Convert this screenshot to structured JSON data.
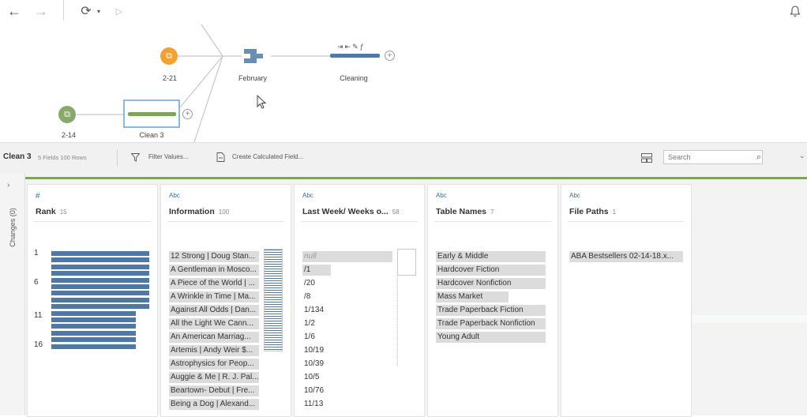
{
  "flow": {
    "nodes": {
      "input_a": "2-21",
      "input_b": "2-14",
      "february": "February",
      "clean3": "Clean 3",
      "cleaning": "Cleaning"
    }
  },
  "step": {
    "name": "Clean 3",
    "meta": "5 Fields  100 Rows",
    "filter_label": "Filter Values...",
    "calc_label": "Create Calculated Field...",
    "search_placeholder": "Search"
  },
  "rail": {
    "changes_label": "Changes (0)"
  },
  "colors": {
    "accent": "#4e79a7",
    "green": "#7fa35a",
    "orange": "#f2a134",
    "node_green": "#89a96a"
  },
  "cards": [
    {
      "type": "#",
      "name": "Rank",
      "count": "15",
      "rank_labels": [
        "1",
        "6",
        "11",
        "16"
      ]
    },
    {
      "type": "Abc",
      "name": "Information",
      "count": "100",
      "values": [
        "12 Strong | Doug Stan...",
        "A Gentleman in Mosco...",
        "A Piece of the World | ...",
        "A Wrinkle in Time | Ma...",
        "Against All Odds | Dan...",
        "All the Light We Cann...",
        "An American Marriag...",
        "Artemis | Andy Weir $...",
        "Astrophysics for Peop...",
        "Auggie & Me | R. J. Pal...",
        "Beartown- Debut | Fre...",
        "Being a Dog | Alexand..."
      ]
    },
    {
      "type": "Abc",
      "name": "Last Week/ Weeks o...",
      "count": "58",
      "values": [
        "null",
        "/1",
        "/20",
        "/8",
        "1/134",
        "1/2",
        "1/6",
        "10/19",
        "10/39",
        "10/5",
        "10/76",
        "11/13"
      ]
    },
    {
      "type": "Abc",
      "name": "Table Names",
      "count": "7",
      "values": [
        "Early & Middle",
        "Hardcover Fiction",
        "Hardcover Nonfiction",
        "Mass Market",
        "Trade Paperback Fiction",
        "Trade Paperback Nonfiction",
        "Young Adult"
      ]
    },
    {
      "type": "Abc",
      "name": "File Paths",
      "count": "1",
      "values": [
        "ABA Bestsellers 02-14-18.x..."
      ]
    }
  ]
}
